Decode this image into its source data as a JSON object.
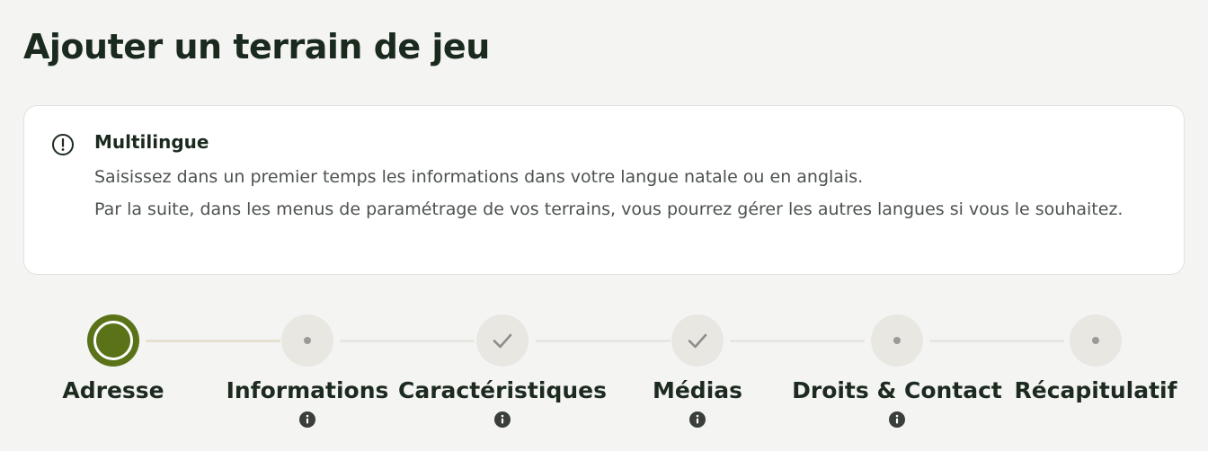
{
  "page": {
    "title": "Ajouter un terrain de jeu"
  },
  "notice": {
    "icon": "exclamation-circle-icon",
    "title": "Multilingue",
    "line1": "Saisissez dans un premier temps les informations dans votre langue natale ou en anglais.",
    "line2": "Par la suite, dans les menus de paramétrage de vos terrains, vous pourrez gérer les autres langues si vous le souhaitez."
  },
  "stepper": {
    "steps": [
      {
        "label": "Adresse",
        "state": "active",
        "info": false
      },
      {
        "label": "Informations",
        "state": "pending",
        "info": true
      },
      {
        "label": "Caractéristiques",
        "state": "done",
        "info": true
      },
      {
        "label": "Médias",
        "state": "done",
        "info": true
      },
      {
        "label": "Droits & Contact",
        "state": "pending",
        "info": true
      },
      {
        "label": "Récapitulatif",
        "state": "pending",
        "info": false
      }
    ]
  },
  "colors": {
    "accent": "#5a7318",
    "background": "#f4f4f3",
    "inactive_step": "#e8e7e2",
    "text_dark": "#1b2a1f"
  }
}
